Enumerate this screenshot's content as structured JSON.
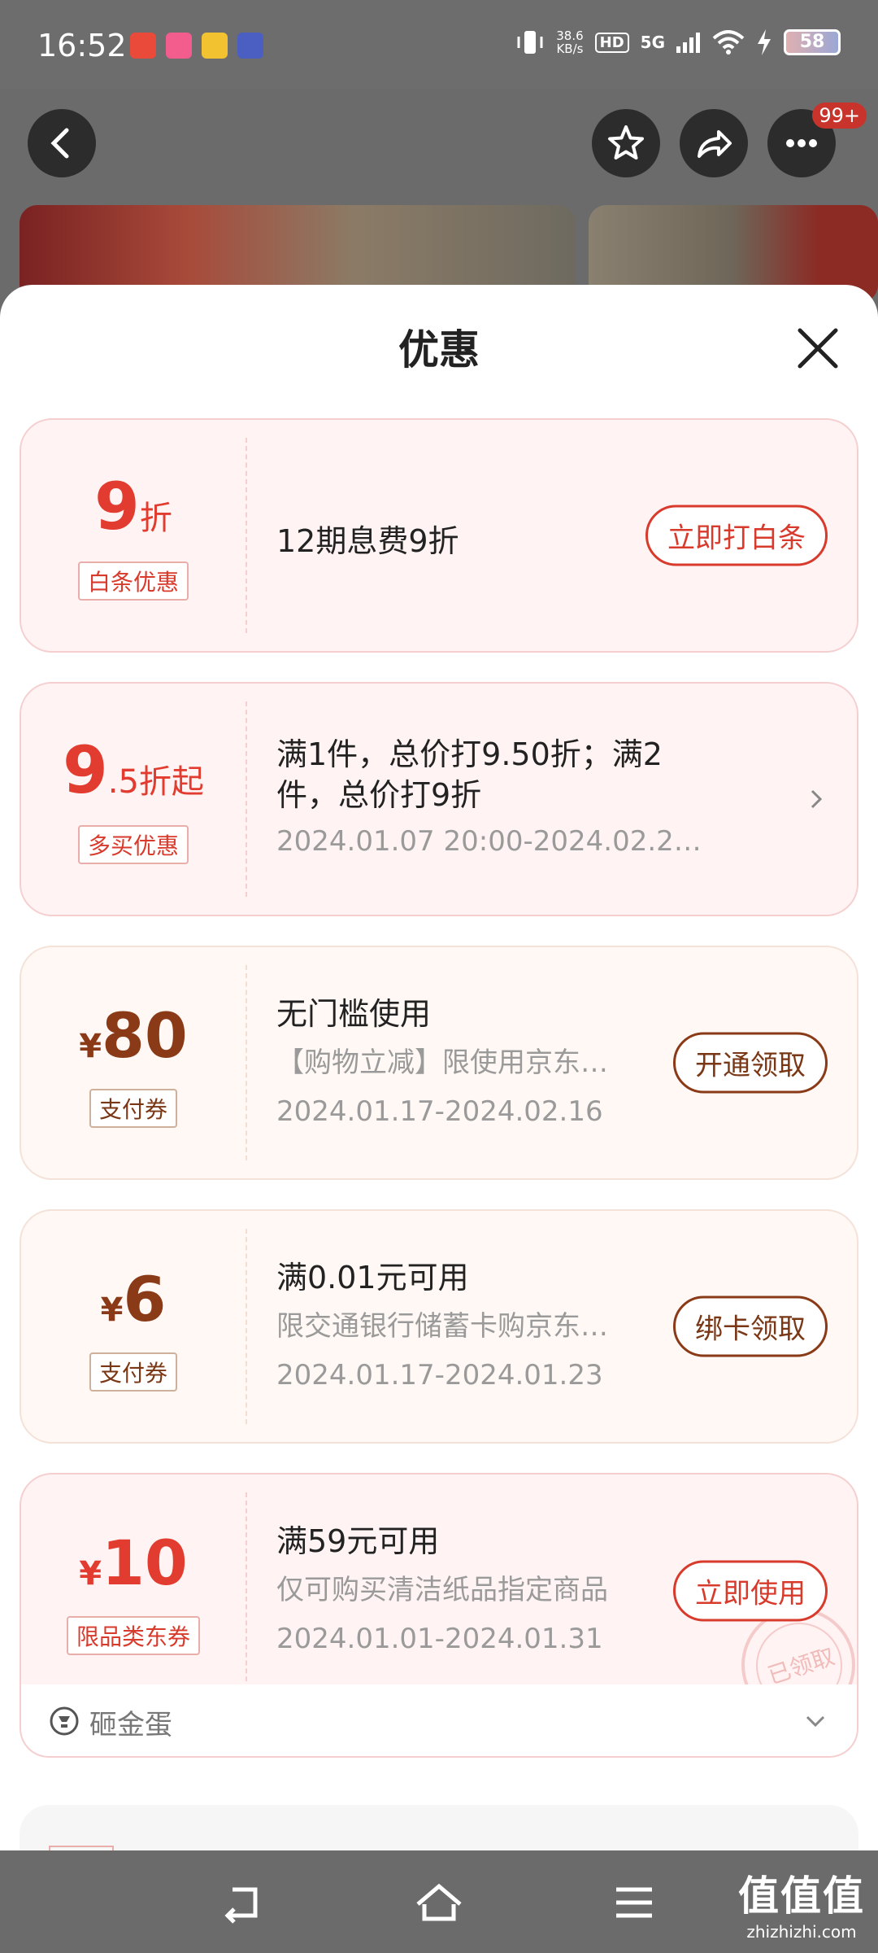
{
  "status_bar": {
    "time": "16:52",
    "net_speed_value": "38.6",
    "net_speed_unit": "KB/s",
    "hd": "HD",
    "network": "5G",
    "battery": "58"
  },
  "header": {
    "more_badge": "99+"
  },
  "sheet": {
    "title": "优惠"
  },
  "offers": [
    {
      "value_main": "9",
      "value_suffix": "折",
      "tag": "白条优惠",
      "title": "12期息费9折",
      "action": "立即打白条"
    },
    {
      "value_main": "9",
      "value_suffix": ".5折起",
      "tag": "多买优惠",
      "title_line1": "满1件，总价打9.50折；满2",
      "title_line2": "件，总价打9折",
      "date": "2024.01.07 20:00-2024.02.2…"
    },
    {
      "currency": "¥",
      "value_main": "80",
      "tag": "支付券",
      "title": "无门槛使用",
      "desc": "【购物立减】限使用京东…",
      "date": "2024.01.17-2024.02.16",
      "action": "开通领取"
    },
    {
      "currency": "¥",
      "value_main": "6",
      "tag": "支付券",
      "title": "满0.01元可用",
      "desc": "限交通银行储蓄卡购京东…",
      "date": "2024.01.17-2024.01.23",
      "action": "绑卡领取"
    },
    {
      "currency": "¥",
      "value_main": "10",
      "tag": "限品类东券",
      "title": "满59元可用",
      "desc": "仅可购买清洁纸品指定商品",
      "date": "2024.01.01-2024.01.31",
      "action": "立即使用",
      "stamp": "已领取"
    }
  ],
  "egg": {
    "label": "砸金蛋"
  },
  "watermark": {
    "main": "值值值",
    "sub": "zhizhizhi.com"
  },
  "colors": {
    "accent_red": "#e23b2f",
    "gold_brown": "#8a3a17",
    "card_bg": "#fff4f3"
  }
}
